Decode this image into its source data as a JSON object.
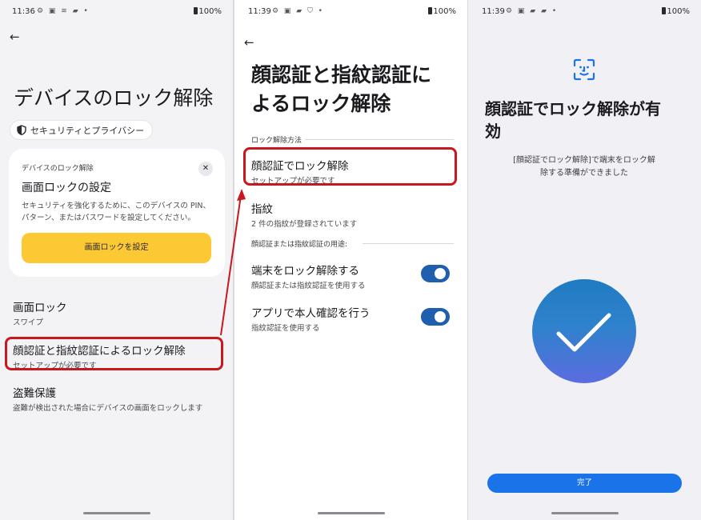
{
  "screen1": {
    "status": {
      "time": "11:36",
      "icons": "⚙ ▣ ≋ ▰ •",
      "battery": "100%"
    },
    "title": "デバイスのロック解除",
    "chip_label": "セキュリティとプライバシー",
    "card": {
      "label": "デバイスのロック解除",
      "title": "画面ロックの設定",
      "desc_line1": "セキュリティを強化するために、このデバイスの PIN、",
      "desc_line2": "パターン、またはパスワードを設定してください。",
      "button": "画面ロックを設定",
      "close": "✕"
    },
    "items": [
      {
        "title": "画面ロック",
        "sub": "スワイプ"
      },
      {
        "title": "顔認証と指紋認証によるロック解除",
        "sub": "セットアップが必要です"
      },
      {
        "title": "盗難保護",
        "sub": "盗難が検出された場合にデバイスの画面をロックします"
      }
    ]
  },
  "screen2": {
    "status": {
      "time": "11:39",
      "icons": "⚙ ▣ ▰ ⛉ •",
      "battery": "100%"
    },
    "title_line1": "顔認証と指紋認証に",
    "title_line2": "よるロック解除",
    "section1": "ロック解除方法",
    "face": {
      "title": "顔認証でロック解除",
      "sub": "セットアップが必要です"
    },
    "fingerprint": {
      "title": "指紋",
      "sub": "2 件の指紋が登録されています"
    },
    "section2": "顔認証または指紋認証の用途:",
    "toggles": [
      {
        "title": "端末をロック解除する",
        "sub": "顔認証または指紋認証を使用する",
        "on": true
      },
      {
        "title": "アプリで本人確認を行う",
        "sub": "指紋認証を使用する",
        "on": true
      }
    ]
  },
  "screen3": {
    "status": {
      "time": "11:39",
      "icons": "⚙ ▣ ▰ ▰ •",
      "battery": "100%"
    },
    "title_line1": "顔認証でロック解除が有",
    "title_line2": "効",
    "body_line1": "[顔認証でロック解除]で端末をロック解",
    "body_line2": "除する準備ができました",
    "done_button": "完了"
  },
  "colors": {
    "highlight": "#c8171e",
    "accent_blue": "#1a73e8",
    "toggle_blue": "#1f5fb0",
    "primary_yellow": "#fcc934"
  }
}
